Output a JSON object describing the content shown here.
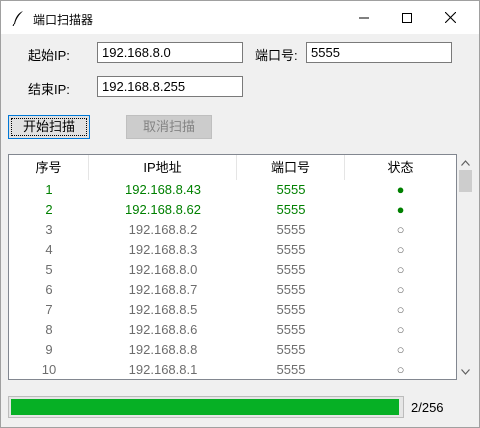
{
  "window": {
    "title": "端口扫描器"
  },
  "form": {
    "start_ip_label": "起始IP:",
    "start_ip_value": "192.168.8.0",
    "end_ip_label": "结束IP:",
    "end_ip_value": "192.168.8.255",
    "port_label": "端口号:",
    "port_value": "5555"
  },
  "buttons": {
    "start": "开始扫描",
    "cancel": "取消扫描"
  },
  "table": {
    "columns": [
      "序号",
      "IP地址",
      "端口号",
      "状态"
    ],
    "rows": [
      {
        "no": "1",
        "ip": "192.168.8.43",
        "port": "5555",
        "status": "●",
        "state": "open"
      },
      {
        "no": "2",
        "ip": "192.168.8.62",
        "port": "5555",
        "status": "●",
        "state": "open"
      },
      {
        "no": "3",
        "ip": "192.168.8.2",
        "port": "5555",
        "status": "○",
        "state": "closed"
      },
      {
        "no": "4",
        "ip": "192.168.8.3",
        "port": "5555",
        "status": "○",
        "state": "closed"
      },
      {
        "no": "5",
        "ip": "192.168.8.0",
        "port": "5555",
        "status": "○",
        "state": "closed"
      },
      {
        "no": "6",
        "ip": "192.168.8.7",
        "port": "5555",
        "status": "○",
        "state": "closed"
      },
      {
        "no": "7",
        "ip": "192.168.8.5",
        "port": "5555",
        "status": "○",
        "state": "closed"
      },
      {
        "no": "8",
        "ip": "192.168.8.6",
        "port": "5555",
        "status": "○",
        "state": "closed"
      },
      {
        "no": "9",
        "ip": "192.168.8.8",
        "port": "5555",
        "status": "○",
        "state": "closed"
      },
      {
        "no": "10",
        "ip": "192.168.8.1",
        "port": "5555",
        "status": "○",
        "state": "closed"
      }
    ]
  },
  "progress": {
    "fraction": 0.996,
    "text": "2/256"
  },
  "colors": {
    "open": "#008000",
    "closed": "#6d6d6d",
    "progress_fill": "#06b025"
  },
  "icons": {
    "app": "feather-icon",
    "minimize": "minimize-icon",
    "maximize": "maximize-icon",
    "close": "close-icon",
    "scroll_up": "chevron-up-icon",
    "scroll_down": "chevron-down-icon"
  }
}
